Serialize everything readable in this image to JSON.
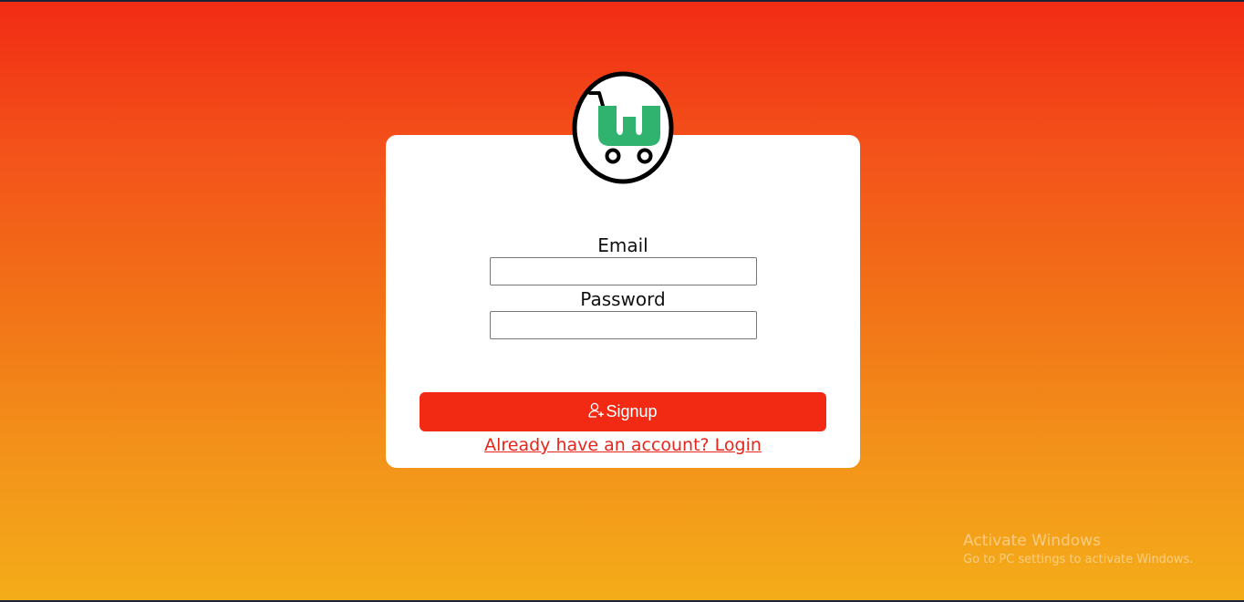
{
  "logo": {
    "icon": "shopping-cart-w-logo-icon",
    "brand_color": "#2fb36f"
  },
  "form": {
    "email_label": "Email",
    "email_value": "",
    "password_label": "Password",
    "password_value": "",
    "signup_label": "Signup",
    "signup_icon": "user-add-icon",
    "login_link": "Already have an account? Login"
  },
  "colors": {
    "gradient_top": "#f22b14",
    "gradient_bottom": "#f4ad19",
    "button": "#f22a14",
    "link": "#e6261c"
  },
  "watermark": {
    "title": "Activate Windows",
    "subtitle": "Go to PC settings to activate Windows."
  }
}
